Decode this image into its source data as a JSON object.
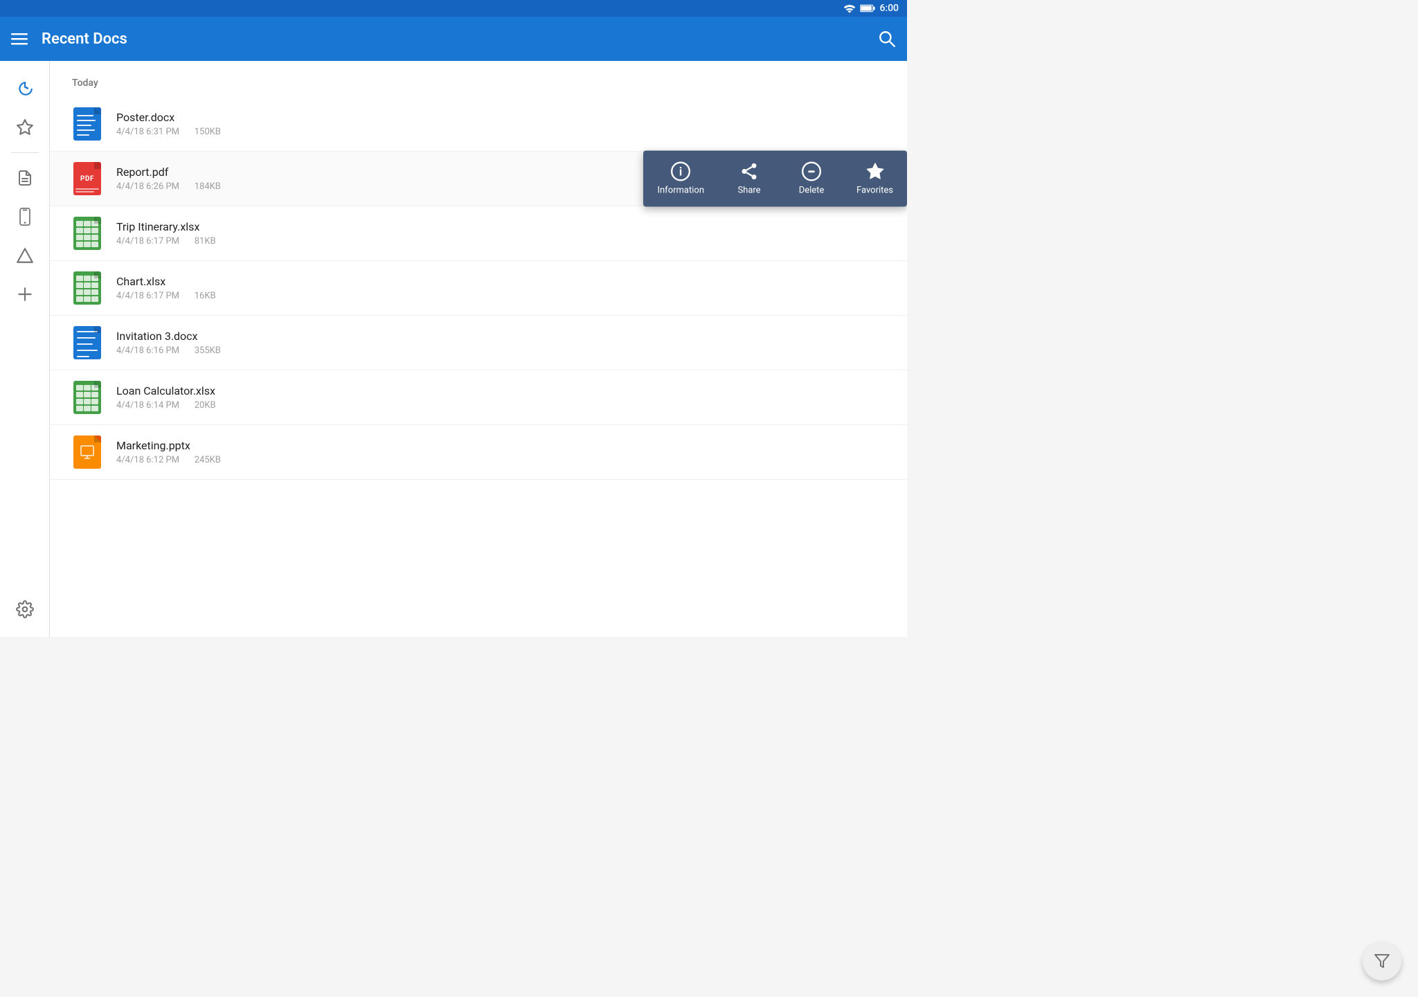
{
  "statusBar": {
    "time": "6:00",
    "icons": [
      "wifi",
      "battery"
    ]
  },
  "appBar": {
    "title": "Recent Docs",
    "menuIcon": "menu",
    "searchIcon": "search"
  },
  "sidebar": {
    "items": [
      {
        "id": "recent",
        "icon": "history",
        "active": true
      },
      {
        "id": "favorites",
        "icon": "star"
      },
      {
        "id": "documents",
        "icon": "doc"
      },
      {
        "id": "device",
        "icon": "smartphone"
      },
      {
        "id": "drive",
        "icon": "drive"
      },
      {
        "id": "add",
        "icon": "add"
      }
    ],
    "bottomItems": [
      {
        "id": "settings",
        "icon": "settings"
      }
    ]
  },
  "sections": [
    {
      "label": "Today",
      "files": [
        {
          "name": "Poster.docx",
          "date": "4/4/18 6:31 PM",
          "size": "150KB",
          "type": "docx",
          "color": "blue"
        },
        {
          "name": "Report.pdf",
          "date": "4/4/18 6:26 PM",
          "size": "184KB",
          "type": "pdf",
          "color": "red",
          "showContextMenu": true
        },
        {
          "name": "Trip Itinerary.xlsx",
          "date": "4/4/18 6:17 PM",
          "size": "81KB",
          "type": "xlsx",
          "color": "green"
        },
        {
          "name": "Chart.xlsx",
          "date": "4/4/18 6:17 PM",
          "size": "16KB",
          "type": "xlsx",
          "color": "green"
        },
        {
          "name": "Invitation 3.docx",
          "date": "4/4/18 6:16 PM",
          "size": "355KB",
          "type": "docx",
          "color": "blue"
        },
        {
          "name": "Loan Calculator.xlsx",
          "date": "4/4/18 6:14 PM",
          "size": "20KB",
          "type": "xlsx",
          "color": "green"
        },
        {
          "name": "Marketing.pptx",
          "date": "4/4/18 6:12 PM",
          "size": "245KB",
          "type": "pptx",
          "color": "orange"
        }
      ]
    }
  ],
  "contextMenu": {
    "items": [
      {
        "id": "information",
        "label": "Information",
        "icon": "info"
      },
      {
        "id": "share",
        "label": "Share",
        "icon": "share"
      },
      {
        "id": "delete",
        "label": "Delete",
        "icon": "delete"
      },
      {
        "id": "favorites",
        "label": "Favorites",
        "icon": "star"
      }
    ]
  },
  "fab": {
    "icon": "filter",
    "label": "Filter"
  }
}
